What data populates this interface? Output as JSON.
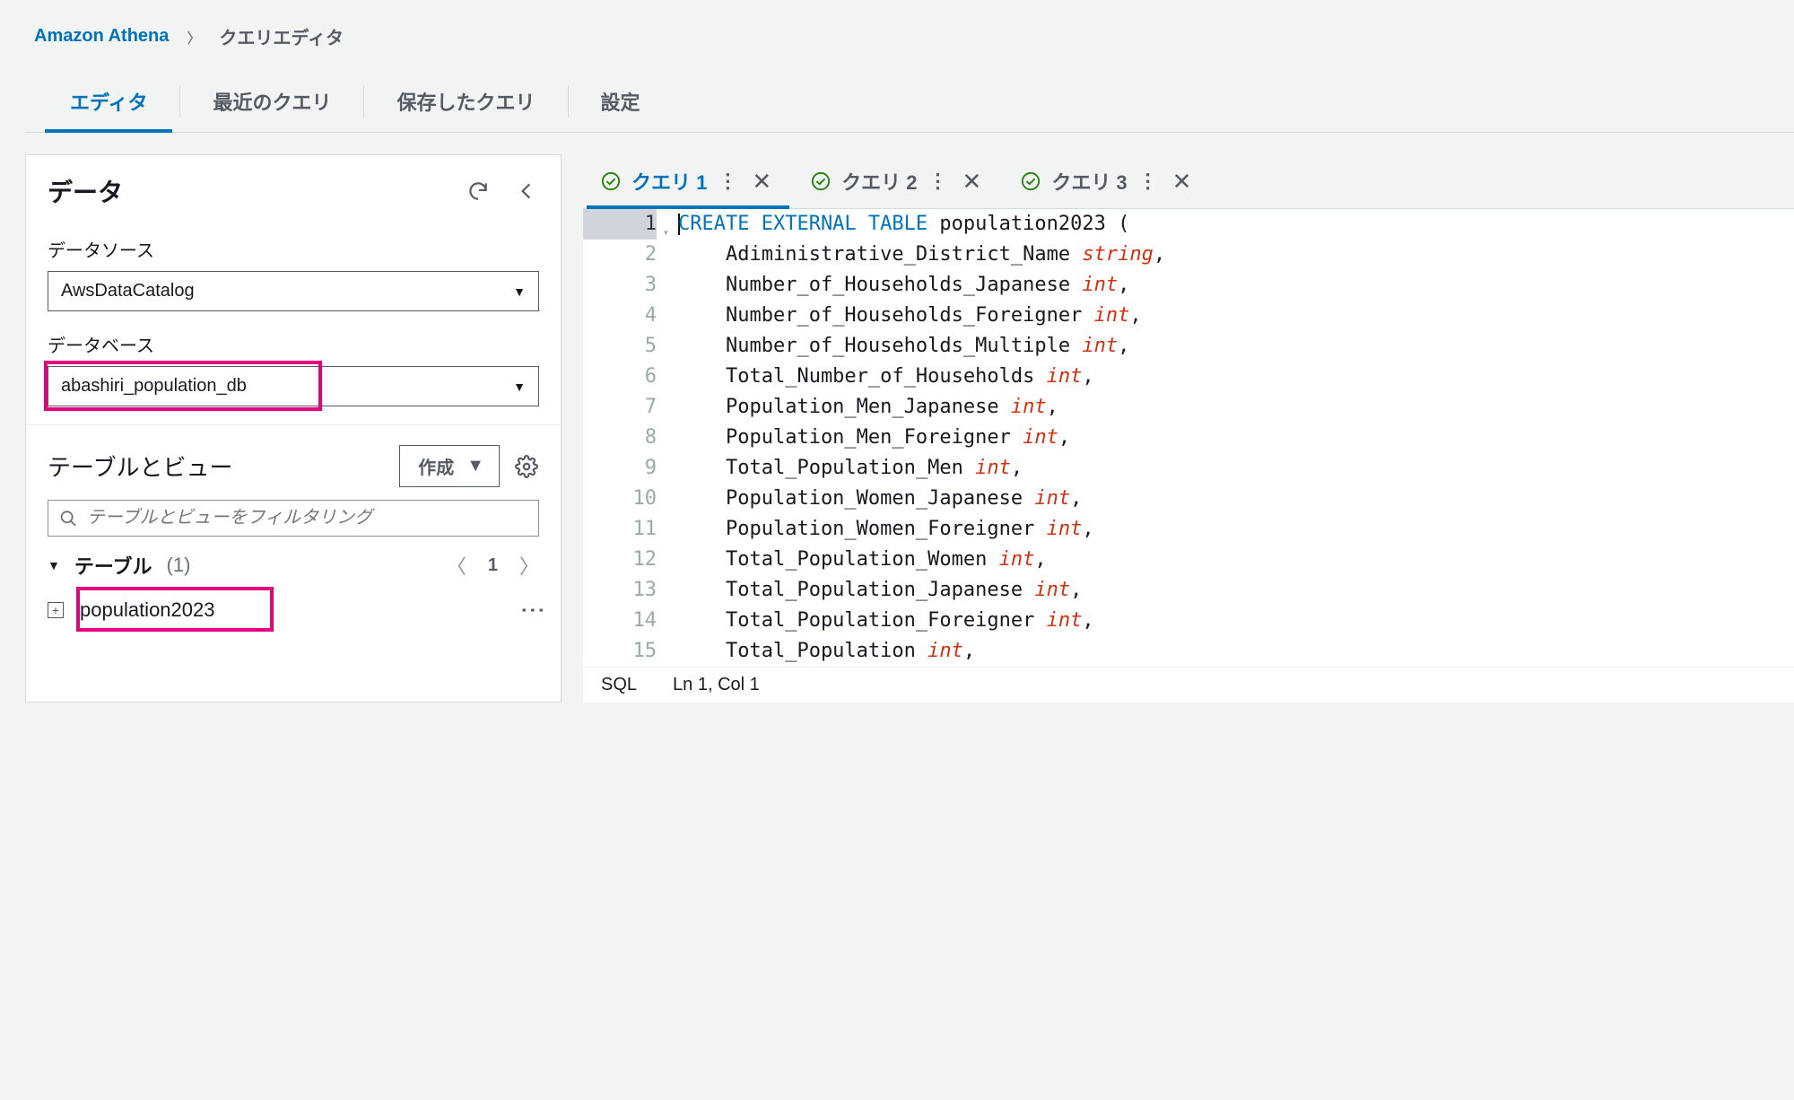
{
  "breadcrumb": {
    "service": "Amazon Athena",
    "current": "クエリエディタ"
  },
  "top_tabs": {
    "editor": "エディタ",
    "recent": "最近のクエリ",
    "saved": "保存したクエリ",
    "settings": "設定"
  },
  "sidebar": {
    "title": "データ",
    "datasource_label": "データソース",
    "datasource_value": "AwsDataCatalog",
    "database_label": "データベース",
    "database_value": "abashiri_population_db",
    "tables_views_title": "テーブルとビュー",
    "create_btn": "作成",
    "filter_placeholder": "テーブルとビューをフィルタリング",
    "tables_header": "テーブル",
    "tables_count": "(1)",
    "page_number": "1",
    "table_items": [
      "population2023"
    ]
  },
  "query_tabs": [
    {
      "label": "クエリ 1",
      "status": "ok",
      "active": true
    },
    {
      "label": "クエリ 2",
      "status": "ok",
      "active": false
    },
    {
      "label": "クエリ 3",
      "status": "ok",
      "active": false
    }
  ],
  "code_lines": [
    {
      "n": 1,
      "tokens": [
        [
          "kw",
          "CREATE EXTERNAL TABLE"
        ],
        [
          "",
          " population2023 ("
        ]
      ]
    },
    {
      "n": 2,
      "tokens": [
        [
          "",
          "    Adiministrative_District_Name "
        ],
        [
          "ty",
          "string"
        ],
        [
          "",
          ","
        ]
      ]
    },
    {
      "n": 3,
      "tokens": [
        [
          "",
          "    Number_of_Households_Japanese "
        ],
        [
          "ty",
          "int"
        ],
        [
          "",
          ","
        ]
      ]
    },
    {
      "n": 4,
      "tokens": [
        [
          "",
          "    Number_of_Households_Foreigner "
        ],
        [
          "ty",
          "int"
        ],
        [
          "",
          ","
        ]
      ]
    },
    {
      "n": 5,
      "tokens": [
        [
          "",
          "    Number_of_Households_Multiple "
        ],
        [
          "ty",
          "int"
        ],
        [
          "",
          ","
        ]
      ]
    },
    {
      "n": 6,
      "tokens": [
        [
          "",
          "    Total_Number_of_Households "
        ],
        [
          "ty",
          "int"
        ],
        [
          "",
          ","
        ]
      ]
    },
    {
      "n": 7,
      "tokens": [
        [
          "",
          "    Population_Men_Japanese "
        ],
        [
          "ty",
          "int"
        ],
        [
          "",
          ","
        ]
      ]
    },
    {
      "n": 8,
      "tokens": [
        [
          "",
          "    Population_Men_Foreigner "
        ],
        [
          "ty",
          "int"
        ],
        [
          "",
          ","
        ]
      ]
    },
    {
      "n": 9,
      "tokens": [
        [
          "",
          "    Total_Population_Men "
        ],
        [
          "ty",
          "int"
        ],
        [
          "",
          ","
        ]
      ]
    },
    {
      "n": 10,
      "tokens": [
        [
          "",
          "    Population_Women_Japanese "
        ],
        [
          "ty",
          "int"
        ],
        [
          "",
          ","
        ]
      ]
    },
    {
      "n": 11,
      "tokens": [
        [
          "",
          "    Population_Women_Foreigner "
        ],
        [
          "ty",
          "int"
        ],
        [
          "",
          ","
        ]
      ]
    },
    {
      "n": 12,
      "tokens": [
        [
          "",
          "    Total_Population_Women "
        ],
        [
          "ty",
          "int"
        ],
        [
          "",
          ","
        ]
      ]
    },
    {
      "n": 13,
      "tokens": [
        [
          "",
          "    Total_Population_Japanese "
        ],
        [
          "ty",
          "int"
        ],
        [
          "",
          ","
        ]
      ]
    },
    {
      "n": 14,
      "tokens": [
        [
          "",
          "    Total_Population_Foreigner "
        ],
        [
          "ty",
          "int"
        ],
        [
          "",
          ","
        ]
      ]
    },
    {
      "n": 15,
      "tokens": [
        [
          "",
          "    Total_Population "
        ],
        [
          "ty",
          "int"
        ],
        [
          "",
          ","
        ]
      ]
    }
  ],
  "status_bar": {
    "lang": "SQL",
    "position": "Ln 1, Col 1"
  }
}
